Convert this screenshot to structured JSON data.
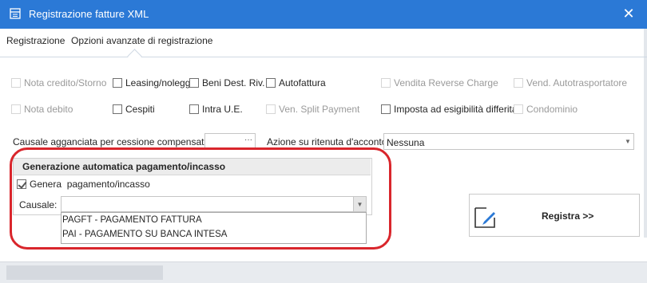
{
  "window": {
    "title": "Registrazione fatture XML"
  },
  "tabs": [
    "Registrazione",
    "Opzioni avanzate di registrazione"
  ],
  "options_row1": [
    {
      "label": "Nota credito/Storno",
      "checked": false,
      "enabled": false
    },
    {
      "label": "Leasing/noleggi",
      "checked": false,
      "enabled": true
    },
    {
      "label": "Beni Dest. Riv.",
      "checked": false,
      "enabled": true
    },
    {
      "label": "Autofattura",
      "checked": false,
      "enabled": true
    },
    {
      "label": "Vendita Reverse Charge",
      "checked": false,
      "enabled": false
    },
    {
      "label": "Vend. Autotrasportatore",
      "checked": false,
      "enabled": false
    }
  ],
  "options_row2": [
    {
      "label": "Nota debito",
      "checked": false,
      "enabled": false
    },
    {
      "label": "Cespiti",
      "checked": false,
      "enabled": true
    },
    {
      "label": "Intra U.E.",
      "checked": false,
      "enabled": true
    },
    {
      "label": "Ven. Split Payment",
      "checked": false,
      "enabled": false
    },
    {
      "label": "Imposta ad esigibilità differita",
      "checked": false,
      "enabled": true
    },
    {
      "label": "Condominio",
      "checked": false,
      "enabled": false
    }
  ],
  "causale_agganciata": {
    "label": "Causale agganciata per cessione compensativa:",
    "value": "",
    "button": "···"
  },
  "azione_ritenuta": {
    "label": "Azione su ritenuta d'acconto",
    "value": "Nessuna"
  },
  "group": {
    "title": "Generazione automatica pagamento/incasso",
    "genera_label": "Genera  pagamento/incasso",
    "genera_checked": true,
    "causale_label": "Causale:",
    "causale_value": "",
    "dropdown_options": [
      "PAGFT - PAGAMENTO FATTURA",
      "PAI - PAGAMENTO SU BANCA INTESA"
    ]
  },
  "register_button": {
    "label": "Registra >>"
  },
  "colors": {
    "titlebar": "#2b79d6",
    "highlight_ring": "#d9262c"
  },
  "icons": {
    "title": "invoice-window-icon",
    "close": "close-icon",
    "register": "edit-pencil-icon"
  }
}
